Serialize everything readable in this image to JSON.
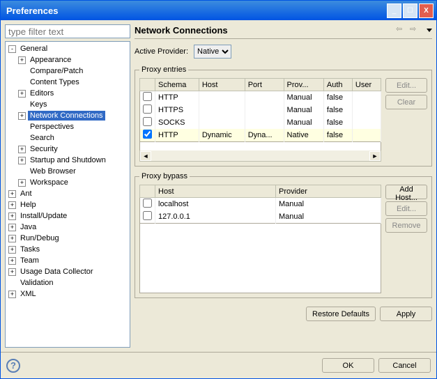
{
  "window": {
    "title": "Preferences"
  },
  "filter": {
    "placeholder": "type filter text"
  },
  "tree": {
    "general": "General",
    "appearance": "Appearance",
    "compare_patch": "Compare/Patch",
    "content_types": "Content Types",
    "editors": "Editors",
    "keys": "Keys",
    "network_connections": "Network Connections",
    "perspectives": "Perspectives",
    "search": "Search",
    "security": "Security",
    "startup_shutdown": "Startup and Shutdown",
    "web_browser": "Web Browser",
    "workspace": "Workspace",
    "ant": "Ant",
    "help": "Help",
    "install_update": "Install/Update",
    "java": "Java",
    "run_debug": "Run/Debug",
    "tasks": "Tasks",
    "team": "Team",
    "usage_data": "Usage Data Collector",
    "validation": "Validation",
    "xml": "XML"
  },
  "page": {
    "heading": "Network Connections",
    "active_provider_label": "Active Provider:",
    "active_provider_value": "Native"
  },
  "proxy_entries": {
    "legend": "Proxy entries",
    "cols": {
      "schema": "Schema",
      "host": "Host",
      "port": "Port",
      "provider": "Prov...",
      "auth": "Auth",
      "user": "User"
    },
    "rows": [
      {
        "checked": false,
        "schema": "HTTP",
        "host": "",
        "port": "",
        "provider": "Manual",
        "auth": "false",
        "user": ""
      },
      {
        "checked": false,
        "schema": "HTTPS",
        "host": "",
        "port": "",
        "provider": "Manual",
        "auth": "false",
        "user": ""
      },
      {
        "checked": false,
        "schema": "SOCKS",
        "host": "",
        "port": "",
        "provider": "Manual",
        "auth": "false",
        "user": ""
      },
      {
        "checked": true,
        "schema": "HTTP",
        "host": "Dynamic",
        "port": "Dyna...",
        "provider": "Native",
        "auth": "false",
        "user": ""
      }
    ],
    "btn_edit": "Edit...",
    "btn_clear": "Clear"
  },
  "proxy_bypass": {
    "legend": "Proxy bypass",
    "cols": {
      "host": "Host",
      "provider": "Provider"
    },
    "rows": [
      {
        "checked": false,
        "host": "localhost",
        "provider": "Manual"
      },
      {
        "checked": false,
        "host": "127.0.0.1",
        "provider": "Manual"
      }
    ],
    "btn_add": "Add Host...",
    "btn_edit": "Edit...",
    "btn_remove": "Remove"
  },
  "buttons": {
    "restore_defaults": "Restore Defaults",
    "apply": "Apply",
    "ok": "OK",
    "cancel": "Cancel"
  }
}
